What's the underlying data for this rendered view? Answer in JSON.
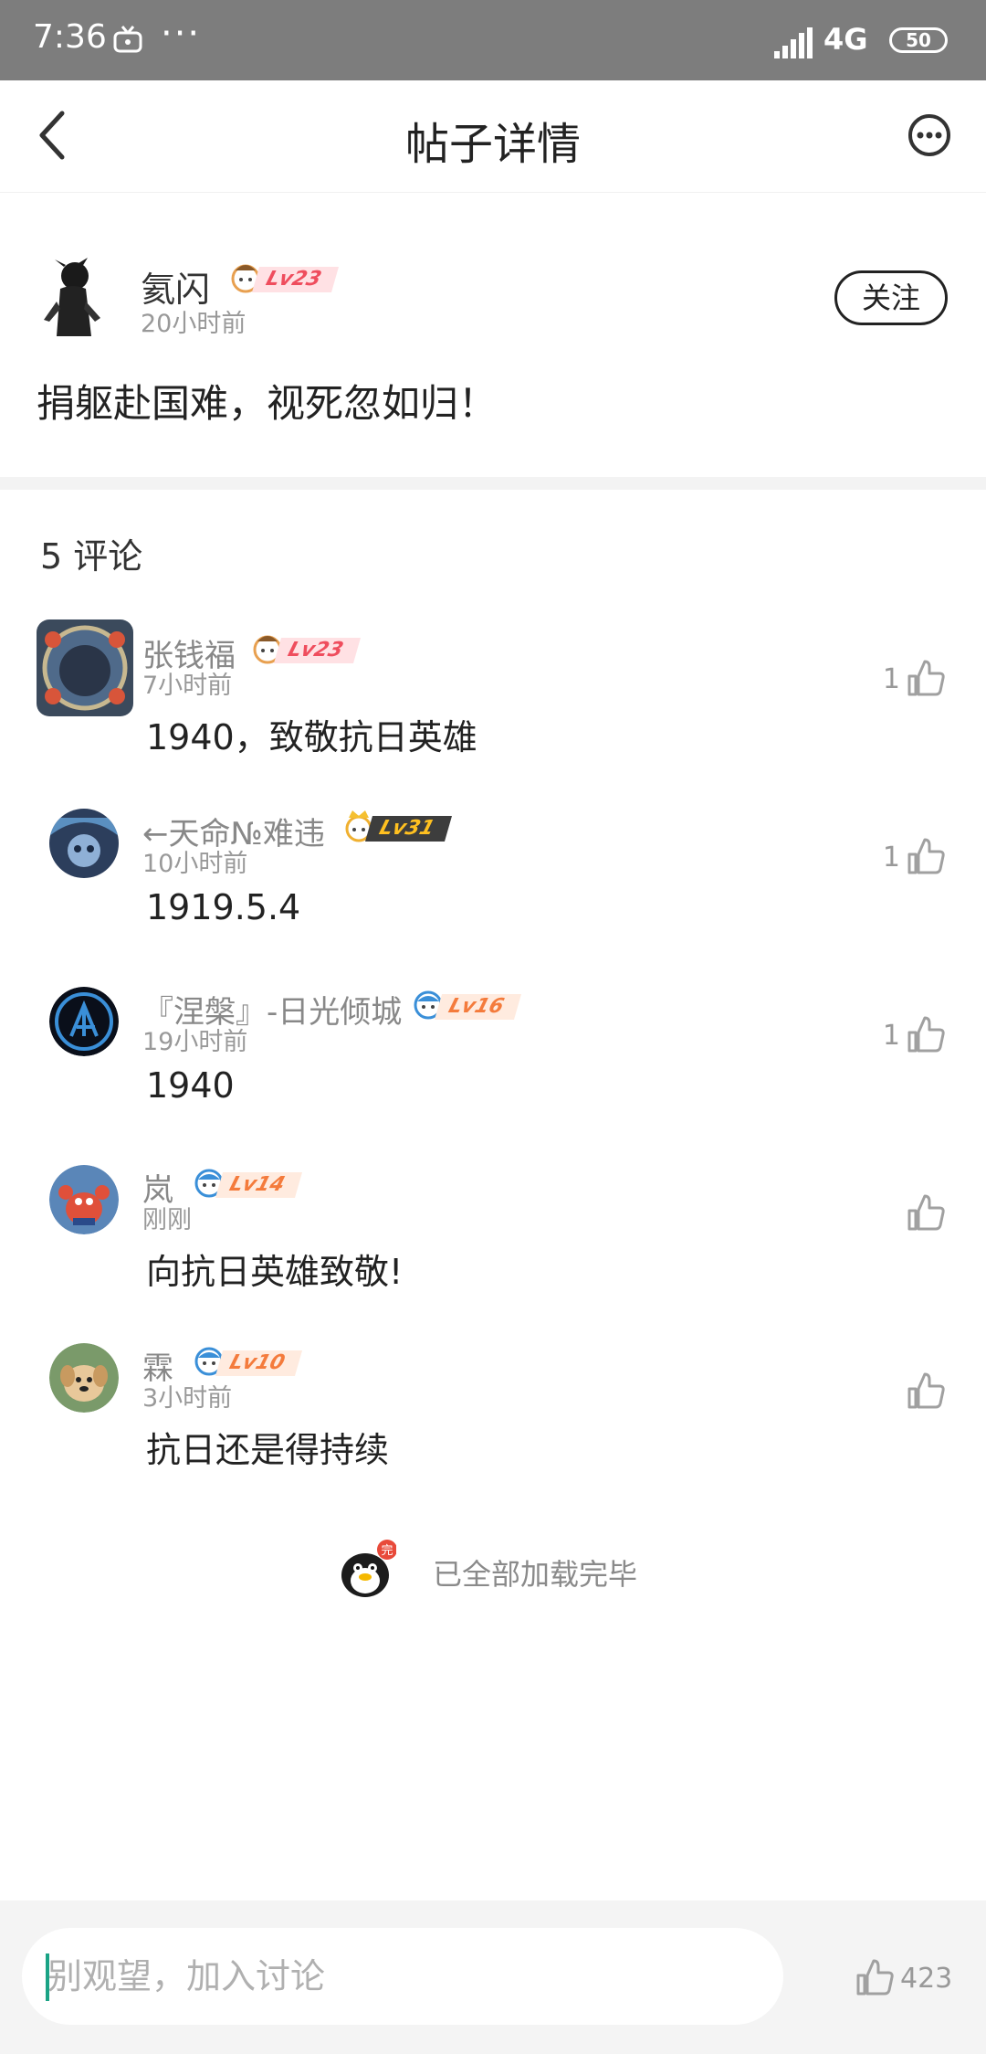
{
  "status_bar": {
    "time": "7:36",
    "dots": "···",
    "network": "4G",
    "battery": "50"
  },
  "header": {
    "title": "帖子详情"
  },
  "post": {
    "author": "氦闪",
    "level": "Lv23",
    "time": "20小时前",
    "follow_label": "关注",
    "body": "捐躯赴国难，视死忽如归！"
  },
  "comments_header": "5 评论",
  "comments": [
    {
      "name": "张钱福",
      "level": "Lv23",
      "time": "7小时前",
      "text": "1940，致敬抗日英雄",
      "likes": "1"
    },
    {
      "name": "←天命№难违",
      "level": "Lv31",
      "time": "10小时前",
      "text": "1919.5.4",
      "likes": "1"
    },
    {
      "name": "『涅槃』-日光倾城",
      "level": "Lv16",
      "time": "19小时前",
      "text": "1940",
      "likes": "1"
    },
    {
      "name": "岚",
      "level": "Lv14",
      "time": "刚刚",
      "text": "向抗日英雄致敬!",
      "likes": ""
    },
    {
      "name": "霖",
      "level": "Lv10",
      "time": "3小时前",
      "text": "抗日还是得持续",
      "likes": ""
    }
  ],
  "end_message": "已全部加载完毕",
  "end_mascot_badge": "完",
  "bottom_bar": {
    "input_placeholder": "别观望，加入讨论",
    "like_count": "423"
  },
  "colors": {
    "status_bar": "#7d7d7d",
    "level_pink": "#ef4d5d",
    "level_orange": "#f47b3c",
    "level_dark": "#3d3d3d",
    "caret": "#1aa385"
  }
}
